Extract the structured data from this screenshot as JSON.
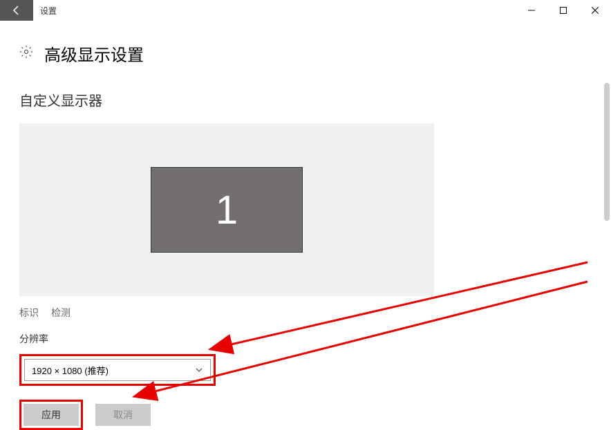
{
  "titlebar": {
    "title": "设置"
  },
  "page": {
    "heading": "高级显示设置",
    "section_heading": "自定义显示器",
    "monitor_number": "1"
  },
  "links": {
    "identify": "标识",
    "detect": "检测"
  },
  "resolution": {
    "label": "分辨率",
    "selected": "1920 × 1080 (推荐)"
  },
  "buttons": {
    "apply": "应用",
    "cancel": "取消"
  },
  "annotation": {
    "color": "#e60000"
  }
}
